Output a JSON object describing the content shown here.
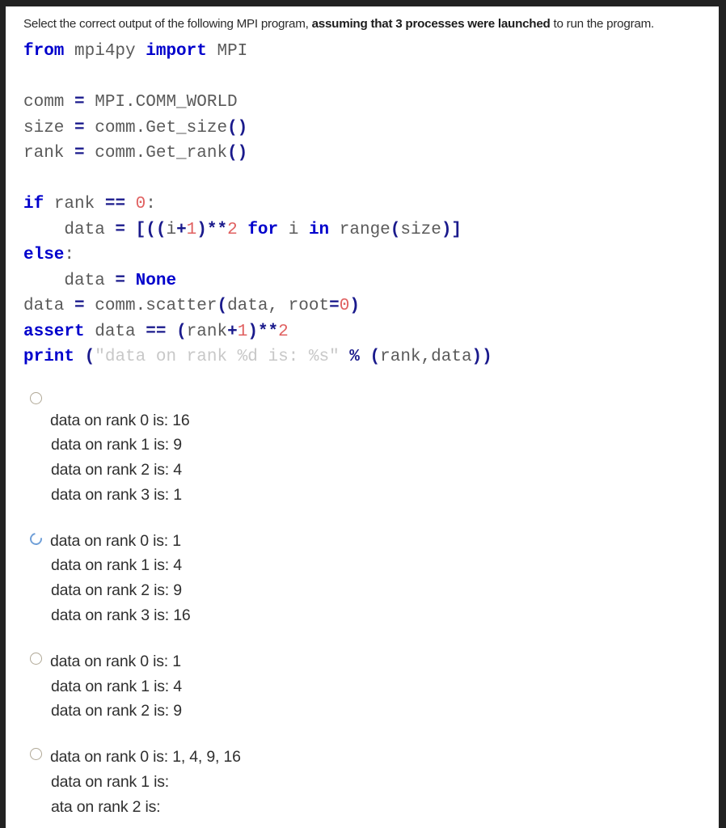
{
  "prompt": {
    "lead": "Select the correct output of the following MPI program, ",
    "emphasis": "assuming that 3 processes were launched",
    "tail": " to run the program."
  },
  "code": {
    "language": "python",
    "lines": [
      [
        {
          "t": "from",
          "c": "kw"
        },
        {
          "t": " mpi4py ",
          "c": "id"
        },
        {
          "t": "import",
          "c": "kw"
        },
        {
          "t": " MPI",
          "c": "id"
        }
      ],
      [],
      [
        {
          "t": "comm ",
          "c": "id"
        },
        {
          "t": "=",
          "c": "op"
        },
        {
          "t": " MPI.COMM_WORLD",
          "c": "id"
        }
      ],
      [
        {
          "t": "size ",
          "c": "id"
        },
        {
          "t": "=",
          "c": "op"
        },
        {
          "t": " comm.Get_size",
          "c": "id"
        },
        {
          "t": "()",
          "c": "pn"
        }
      ],
      [
        {
          "t": "rank ",
          "c": "id"
        },
        {
          "t": "=",
          "c": "op"
        },
        {
          "t": " comm.Get_rank",
          "c": "id"
        },
        {
          "t": "()",
          "c": "pn"
        }
      ],
      [],
      [
        {
          "t": "if",
          "c": "kw"
        },
        {
          "t": " rank ",
          "c": "id"
        },
        {
          "t": "==",
          "c": "op"
        },
        {
          "t": " ",
          "c": "id"
        },
        {
          "t": "0",
          "c": "num"
        },
        {
          "t": ":",
          "c": "id"
        }
      ],
      [
        {
          "t": "    data ",
          "c": "id"
        },
        {
          "t": "=",
          "c": "op"
        },
        {
          "t": " ",
          "c": "id"
        },
        {
          "t": "[((",
          "c": "pn"
        },
        {
          "t": "i",
          "c": "id"
        },
        {
          "t": "+",
          "c": "op"
        },
        {
          "t": "1",
          "c": "num"
        },
        {
          "t": ")",
          "c": "pn"
        },
        {
          "t": "**",
          "c": "op"
        },
        {
          "t": "2",
          "c": "num"
        },
        {
          "t": " ",
          "c": "id"
        },
        {
          "t": "for",
          "c": "kw"
        },
        {
          "t": " i ",
          "c": "id"
        },
        {
          "t": "in",
          "c": "kw"
        },
        {
          "t": " range",
          "c": "id"
        },
        {
          "t": "(",
          "c": "pn"
        },
        {
          "t": "size",
          "c": "id"
        },
        {
          "t": ")]",
          "c": "pn"
        }
      ],
      [
        {
          "t": "else",
          "c": "kw"
        },
        {
          "t": ":",
          "c": "id"
        }
      ],
      [
        {
          "t": "    data ",
          "c": "id"
        },
        {
          "t": "=",
          "c": "op"
        },
        {
          "t": " ",
          "c": "id"
        },
        {
          "t": "None",
          "c": "kw"
        }
      ],
      [
        {
          "t": "data ",
          "c": "id"
        },
        {
          "t": "=",
          "c": "op"
        },
        {
          "t": " comm.scatter",
          "c": "id"
        },
        {
          "t": "(",
          "c": "pn"
        },
        {
          "t": "data, root",
          "c": "id"
        },
        {
          "t": "=",
          "c": "op"
        },
        {
          "t": "0",
          "c": "num"
        },
        {
          "t": ")",
          "c": "pn"
        }
      ],
      [
        {
          "t": "assert",
          "c": "kw"
        },
        {
          "t": " data ",
          "c": "id"
        },
        {
          "t": "==",
          "c": "op"
        },
        {
          "t": " ",
          "c": "id"
        },
        {
          "t": "(",
          "c": "pn"
        },
        {
          "t": "rank",
          "c": "id"
        },
        {
          "t": "+",
          "c": "op"
        },
        {
          "t": "1",
          "c": "num"
        },
        {
          "t": ")",
          "c": "pn"
        },
        {
          "t": "**",
          "c": "op"
        },
        {
          "t": "2",
          "c": "num"
        }
      ],
      [
        {
          "t": "print",
          "c": "kw"
        },
        {
          "t": " ",
          "c": "id"
        },
        {
          "t": "(",
          "c": "pn"
        },
        {
          "t": "\"data on rank %d is: %s\"",
          "c": "str"
        },
        {
          "t": " ",
          "c": "id"
        },
        {
          "t": "%",
          "c": "op"
        },
        {
          "t": " ",
          "c": "id"
        },
        {
          "t": "(",
          "c": "pn"
        },
        {
          "t": "rank,data",
          "c": "id"
        },
        {
          "t": "))",
          "c": "pn"
        }
      ]
    ]
  },
  "options": [
    {
      "selected": false,
      "lines": [
        "data on rank 0 is: 16",
        "data on rank 1 is: 9",
        "data on rank 2 is: 4",
        "data on rank 3 is: 1"
      ]
    },
    {
      "selected": true,
      "lines": [
        "data on rank 0 is: 1",
        "data on rank 1 is: 4",
        "data on rank 2 is: 9",
        "data on rank 3 is: 16"
      ]
    },
    {
      "selected": false,
      "lines": [
        "data on rank 0 is: 1",
        "data on rank 1 is: 4",
        "data on rank 2 is: 9"
      ]
    },
    {
      "selected": false,
      "lines": [
        "data on rank 0 is: 1, 4, 9, 16",
        "data on rank 1 is:",
        "ata on rank 2 is:"
      ]
    }
  ],
  "colors": {
    "keyword": "#0000cc",
    "number": "#e06060",
    "operator": "#1a1a8c",
    "identifier": "#5a5a5a",
    "string": "#c8c8c8",
    "radio_selected": "#6f9fd8",
    "radio_unselected": "#b0a896",
    "frame": "#222222"
  }
}
